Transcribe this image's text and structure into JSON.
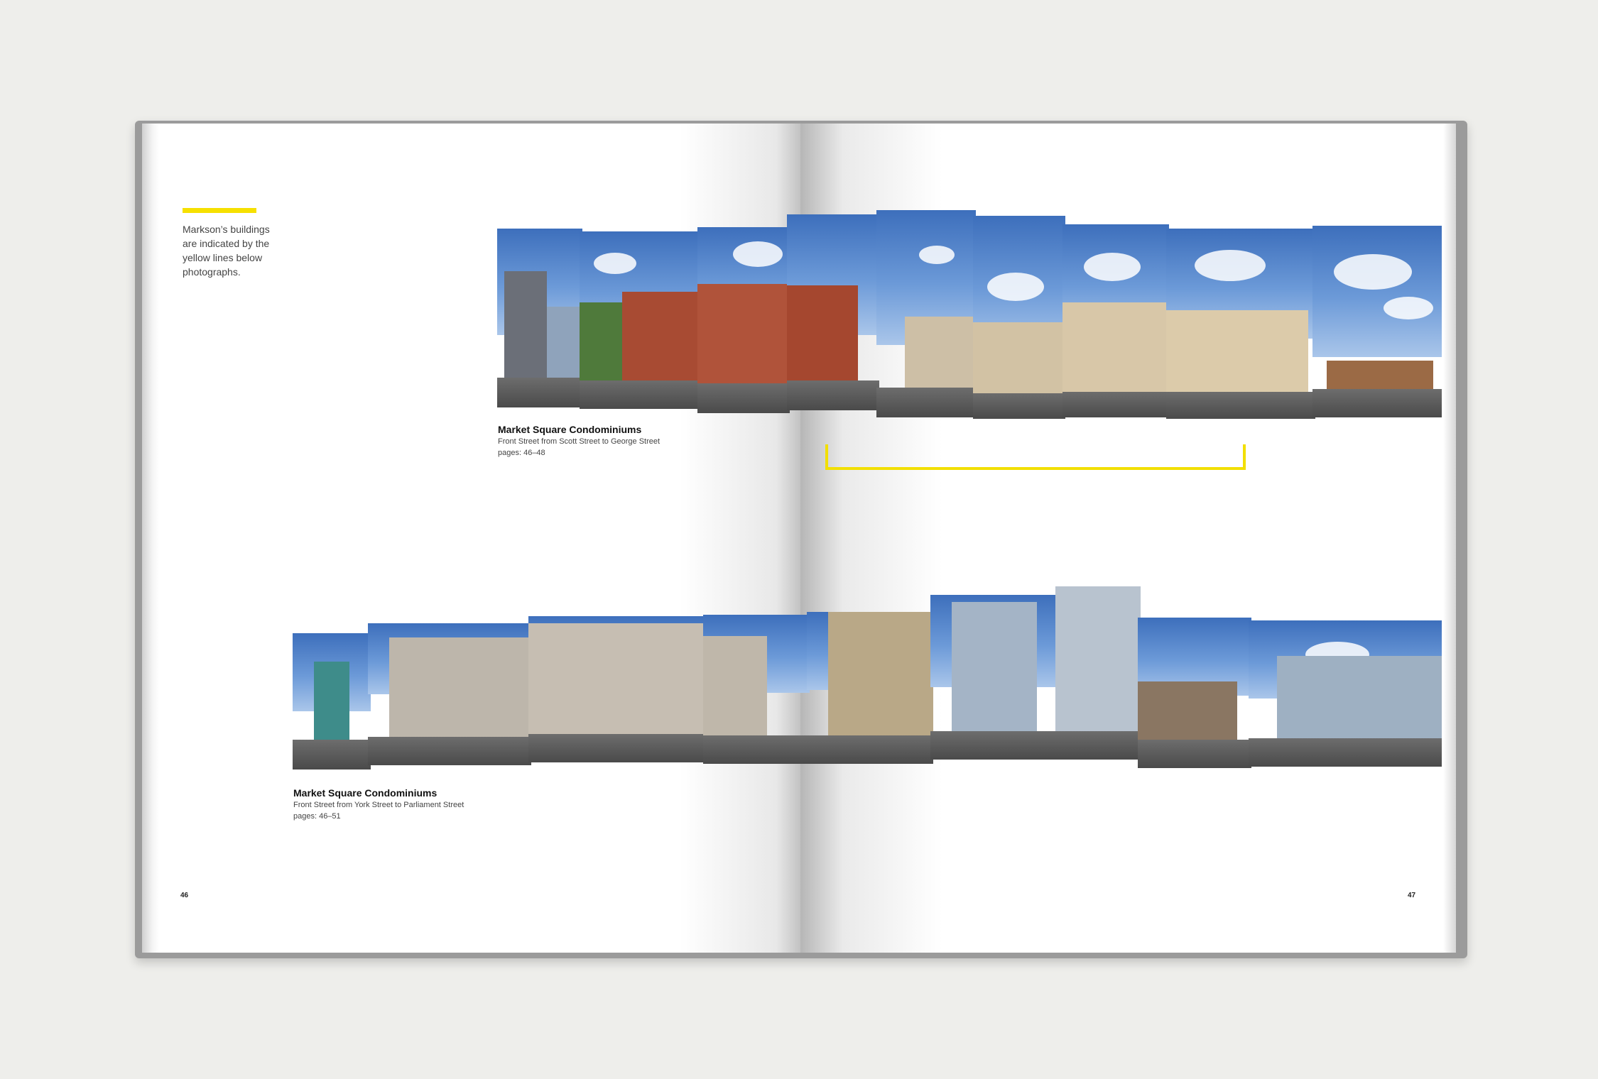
{
  "intro": {
    "text_lines": [
      "Markson’s buildings",
      "are indicated by the",
      "yellow lines below",
      "photographs."
    ]
  },
  "panorama_top": {
    "title": "Market Square Condominiums",
    "subtitle": "Front Street from Scott Street to George Street",
    "pages": "pages: 46–48"
  },
  "panorama_bottom": {
    "title": "Market Square Condominiums",
    "subtitle": "Front Street from York Street to Parliament Street",
    "pages": "pages: 46–51"
  },
  "page_numbers": {
    "left": "46",
    "right": "47"
  },
  "colors": {
    "accent_yellow": "#f6e000",
    "background": "#eeeeeb"
  }
}
